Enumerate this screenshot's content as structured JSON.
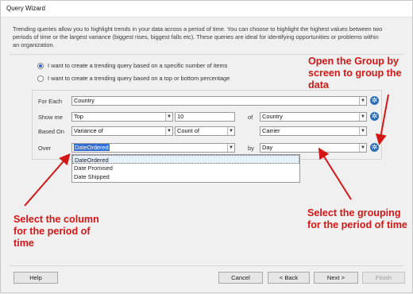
{
  "window": {
    "title": "Query Wizard"
  },
  "description": "Trending queries allow you to highlight trends in your data across a period of time. You can choose to highlight the highest values between two periods of time or the largest variance (biggest rises, biggest falls etc). These queries are ideal for identifying opportunities or problems within an organization.",
  "radio_options": [
    {
      "label": "I want to create a trending query based on a specific number of items",
      "checked": true
    },
    {
      "label": "I want to create a trending query based on a top or bottom percentage",
      "checked": false
    }
  ],
  "form": {
    "for_each": {
      "label": "For Each",
      "value": "Country"
    },
    "show_me": {
      "label": "Show me",
      "mode": "Top",
      "count": "10",
      "of_label": "of",
      "of_value": "Country"
    },
    "based_on": {
      "label": "Based On",
      "measure": "Variance of",
      "aggregate": "Count of",
      "field": "Carrier"
    },
    "over": {
      "label": "Over",
      "value": "DateOrdered",
      "by_label": "by",
      "by_value": "Day"
    }
  },
  "over_dropdown_options": [
    "DateOrdered",
    "Date Promised",
    "Date Shipped"
  ],
  "annotations": {
    "group_by": "Open the Group by screen to group the data",
    "column": "Select the column for the period of time",
    "grouping": "Select the grouping for the period of time"
  },
  "buttons": {
    "help": "Help",
    "cancel": "Cancel",
    "back": "< Back",
    "next": "Next >",
    "finish": "Finish"
  },
  "colors": {
    "annotation": "#d41616",
    "accent": "#2f6ed6",
    "gear": "#2d6fb6"
  },
  "icons": {
    "dropdown": "chevron-down-icon",
    "options": "gear-icon",
    "radio": "radio-button-icon"
  }
}
